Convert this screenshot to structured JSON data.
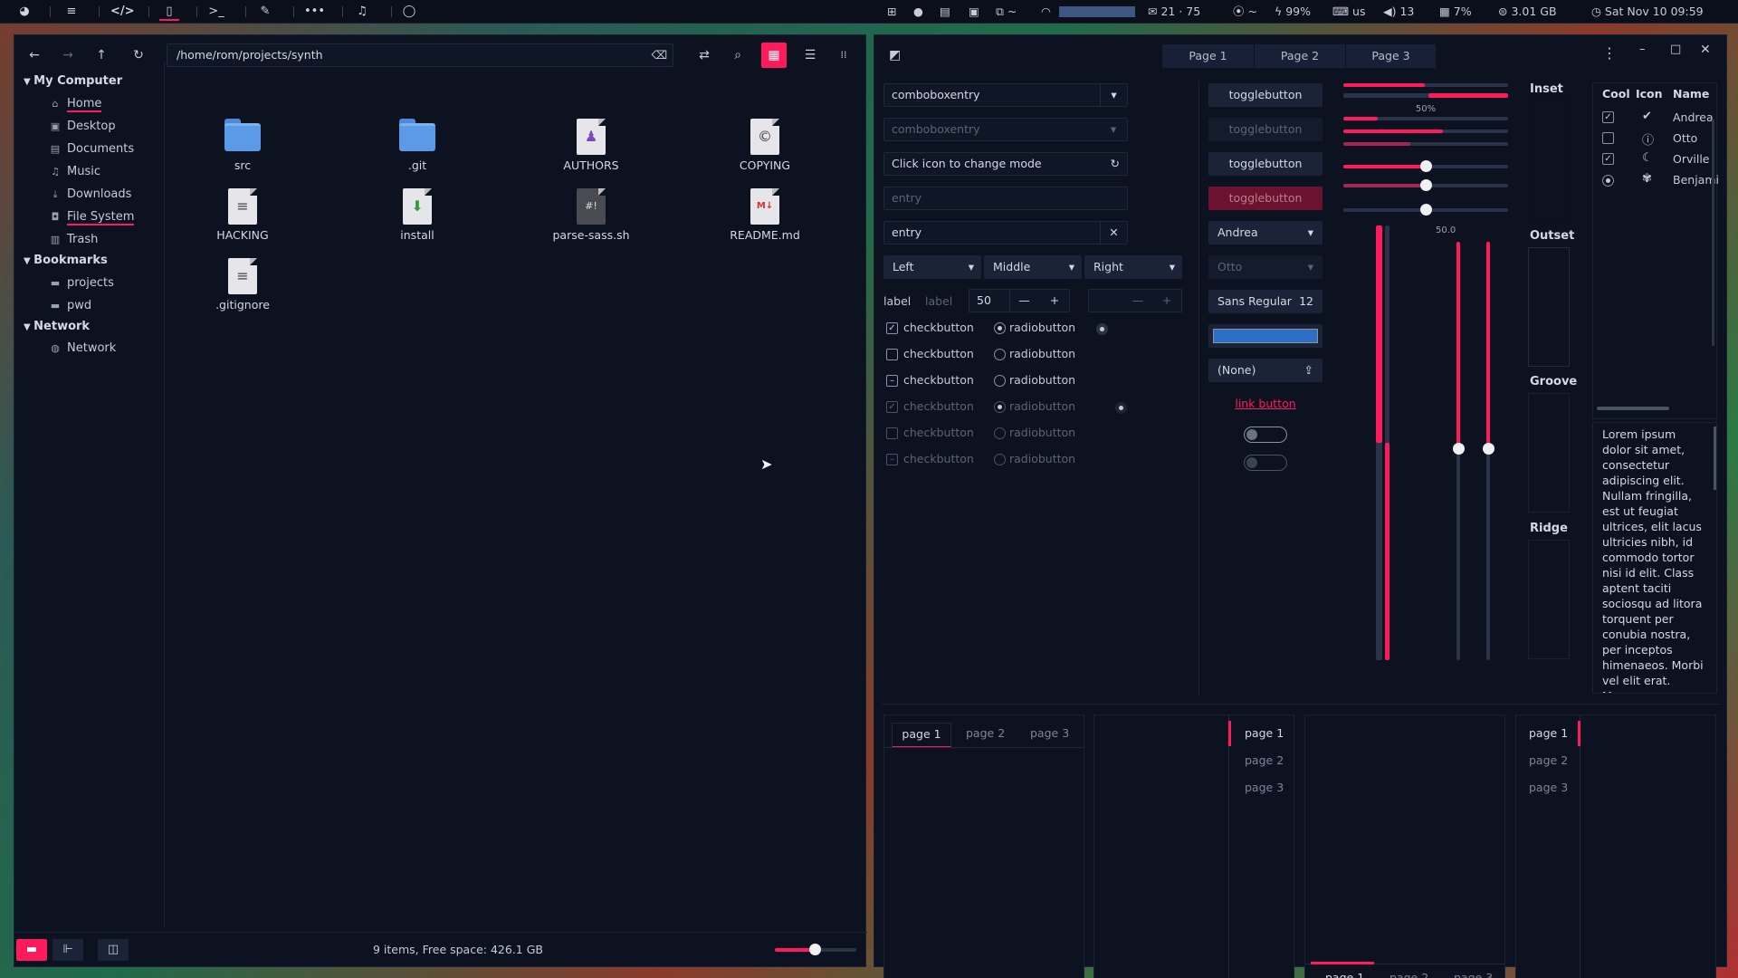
{
  "topbar": {
    "tray": {
      "mail": "21 · 75",
      "battery": "99%",
      "keyboard": "us",
      "volume": "13",
      "cpu": "7%",
      "memory": "3.01 GB",
      "clock": "Sat Nov 10 09:59"
    }
  },
  "filemanager": {
    "path": "/home/rom/projects/synth",
    "sidebar": {
      "my_computer": "My Computer",
      "computer_items": [
        {
          "label": "Home",
          "icon": "home-icon"
        },
        {
          "label": "Desktop",
          "icon": "desktop-icon"
        },
        {
          "label": "Documents",
          "icon": "documents-icon"
        },
        {
          "label": "Music",
          "icon": "music-icon"
        },
        {
          "label": "Downloads",
          "icon": "downloads-icon"
        },
        {
          "label": "File System",
          "icon": "drive-icon"
        },
        {
          "label": "Trash",
          "icon": "trash-icon"
        }
      ],
      "bookmarks": "Bookmarks",
      "bookmark_items": [
        {
          "label": "projects",
          "icon": "folder-icon"
        },
        {
          "label": "pwd",
          "icon": "folder-icon"
        }
      ],
      "network": "Network",
      "network_items": [
        {
          "label": "Network",
          "icon": "network-icon"
        }
      ]
    },
    "files": [
      {
        "name": "src",
        "kind": "folder"
      },
      {
        "name": ".git",
        "kind": "folder"
      },
      {
        "name": "AUTHORS",
        "kind": "authors"
      },
      {
        "name": "COPYING",
        "kind": "copying"
      },
      {
        "name": "HACKING",
        "kind": "text"
      },
      {
        "name": "install",
        "kind": "install"
      },
      {
        "name": "parse-sass.sh",
        "kind": "script"
      },
      {
        "name": "README.md",
        "kind": "markdown"
      },
      {
        "name": ".gitignore",
        "kind": "text"
      }
    ],
    "status": "9 items, Free space: 426.1 GB",
    "zoom_slider_fraction": 0.5
  },
  "widgets": {
    "tabs": [
      "Page 1",
      "Page 2",
      "Page 3"
    ],
    "active_tab": 0,
    "col1": {
      "combo1": "comboboxentry",
      "combo2": "comboboxentry",
      "mode_entry": "Click icon to change mode",
      "entry_placeholder": "entry",
      "entry_value": "entry",
      "dropdowns": [
        "Left",
        "Middle",
        "Right"
      ],
      "label1": "label",
      "label2": "label",
      "spin_value": "50",
      "check_label": "checkbutton",
      "radio_label": "radiobutton"
    },
    "col2": {
      "toggle": "togglebutton",
      "combo_andrea": "Andrea",
      "combo_otto": "Otto",
      "font": "Sans Regular",
      "font_size": "12",
      "file_chooser": "(None)",
      "link": "link button"
    },
    "sliders": {
      "progress_label": "50%",
      "scale_value": "50.0"
    },
    "frames": [
      "Inset",
      "Outset",
      "Groove",
      "Ridge"
    ],
    "tree": {
      "headers": [
        "Cool",
        "Icon",
        "Name"
      ],
      "rows": [
        {
          "name": "Andrea",
          "check": "checked",
          "icon": "check-circle-icon"
        },
        {
          "name": "Otto",
          "check": "empty",
          "icon": "info-icon"
        },
        {
          "name": "Orville",
          "check": "checked",
          "icon": "moon-icon"
        },
        {
          "name": "Benjamin",
          "check": "radio",
          "icon": "emblem-icon"
        }
      ]
    },
    "lorem": "Lorem ipsum dolor sit amet, consectetur adipiscing elit. Nullam fringilla, est ut feugiat ultrices, elit lacus ultricies nibh, id commodo tortor nisi id elit. Class aptent taciti sociosqu ad litora torquent per conubia nostra, per inceptos himenaeos. Morbi vel elit erat. Maecenas",
    "notebook_tabs": [
      "page 1",
      "page 2",
      "page 3"
    ]
  },
  "colors": {
    "accent": "#ff1a5c",
    "background": "#0c1220"
  }
}
